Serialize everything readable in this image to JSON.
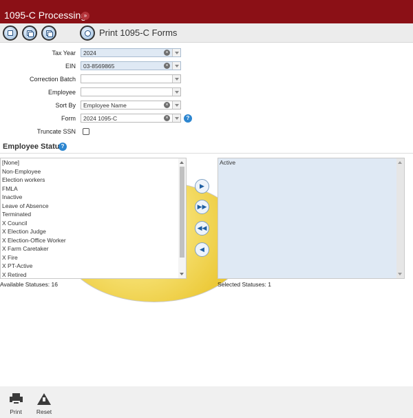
{
  "app": {
    "title": "1095-C Processing",
    "page_title": "Print 1095-C Forms"
  },
  "icons": {
    "breadcrumb": "chevron-right-circle-icon",
    "toolbar": [
      "tax-form-icon",
      "form-copy-icon",
      "form-list-icon",
      "print-forms-icon",
      "wrench-icon"
    ]
  },
  "form": {
    "tax_year": {
      "label": "Tax Year",
      "value": "2024"
    },
    "ein": {
      "label": "EIN",
      "value": "03-8569865"
    },
    "correction_batch": {
      "label": "Correction Batch",
      "value": ""
    },
    "employee": {
      "label": "Employee",
      "value": ""
    },
    "sort_by": {
      "label": "Sort By",
      "value": "Employee Name"
    },
    "form": {
      "label": "Form",
      "value": "2024 1095-C"
    },
    "truncate_ssn": {
      "label": "Truncate SSN",
      "checked": false
    }
  },
  "employee_status": {
    "heading": "Employee Status",
    "available": [
      "[None]",
      "Non-Employee",
      "Election workers",
      "FMLA",
      "Inactive",
      "Leave of Absence",
      "Terminated",
      "X Council",
      "X Election Judge",
      "X Election-Office Worker",
      "X Farm Caretaker",
      "X Fire",
      "X PT-Active",
      "X Retired"
    ],
    "selected": [
      "Active"
    ],
    "available_count": "Available Statuses: 16",
    "selected_count": "Selected Statuses: 1"
  },
  "footer": {
    "print_label": "Print",
    "reset_label": "Reset"
  },
  "colors": {
    "titlebar": "#8b1016",
    "selected_field_bg": "#dfe9f4",
    "help_badge": "#2d86d0"
  }
}
